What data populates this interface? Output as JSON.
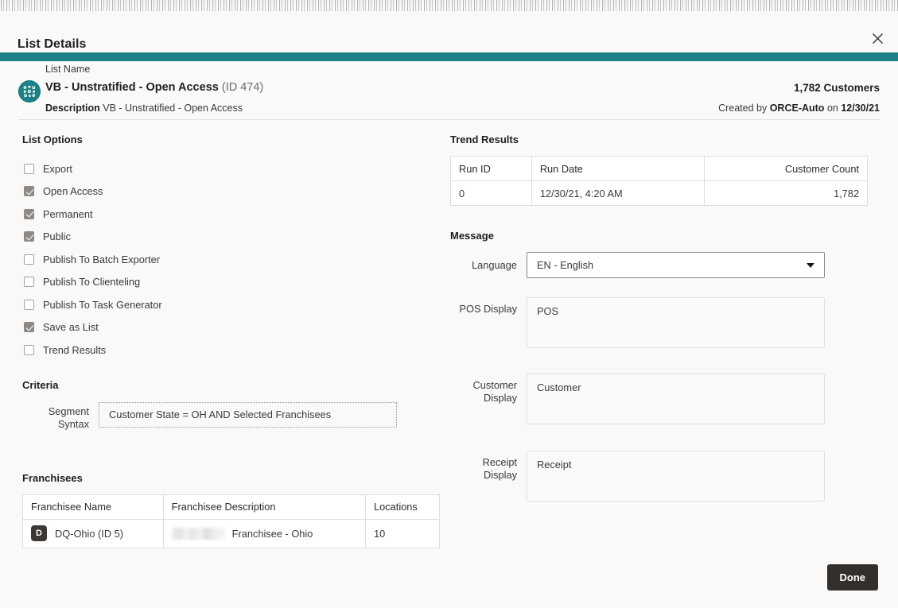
{
  "dialog": {
    "title": "List Details",
    "close_icon": "close-icon"
  },
  "header": {
    "list_icon": "customer-list-icon",
    "list_name_label": "List Name",
    "list_name": "VB - Unstratified - Open Access",
    "list_id": "(ID 474)",
    "description_label": "Description",
    "description_value": "VB - Unstratified - Open Access",
    "customer_count": "1,782 Customers",
    "created_prefix": "Created by",
    "created_by": "ORCE-Auto",
    "created_on_word": "on",
    "created_date": "12/30/21"
  },
  "list_options": {
    "heading": "List Options",
    "items": [
      {
        "label": "Export",
        "checked": false
      },
      {
        "label": "Open Access",
        "checked": true
      },
      {
        "label": "Permanent",
        "checked": true
      },
      {
        "label": "Public",
        "checked": true
      },
      {
        "label": "Publish To Batch Exporter",
        "checked": false
      },
      {
        "label": "Publish To Clienteling",
        "checked": false
      },
      {
        "label": "Publish To Task Generator",
        "checked": false
      },
      {
        "label": "Save as List",
        "checked": true
      },
      {
        "label": "Trend Results",
        "checked": false
      }
    ]
  },
  "criteria": {
    "heading": "Criteria",
    "segment_syntax_label": "Segment Syntax",
    "segment_syntax_value": "Customer State = OH AND Selected Franchisees"
  },
  "franchisees": {
    "heading": "Franchisees",
    "columns": [
      "Franchisee Name",
      "Franchisee Description",
      "Locations"
    ],
    "rows": [
      {
        "badge": "D",
        "name": "DQ-Ohio (ID 5)",
        "description_redacted": true,
        "description": "Franchisee - Ohio",
        "locations": "10"
      }
    ]
  },
  "trend_results": {
    "heading": "Trend Results",
    "columns": [
      "Run ID",
      "Run Date",
      "Customer Count"
    ],
    "rows": [
      {
        "run_id": "0",
        "run_date": "12/30/21, 4:20 AM",
        "customer_count": "1,782"
      }
    ]
  },
  "message": {
    "heading": "Message",
    "language_label": "Language",
    "language_value": "EN - English",
    "language_caret_icon": "chevron-down-icon",
    "pos_display_label": "POS Display",
    "pos_display_value": "POS",
    "customer_display_label": "Customer Display",
    "customer_display_value": "Customer",
    "receipt_display_label": "Receipt Display",
    "receipt_display_value": "Receipt"
  },
  "footer": {
    "done_label": "Done"
  },
  "colors": {
    "accent_teal": "#1c8085",
    "page_bg": "#faf9f8",
    "done_button": "#332f2d",
    "border": "#e0dedc"
  }
}
